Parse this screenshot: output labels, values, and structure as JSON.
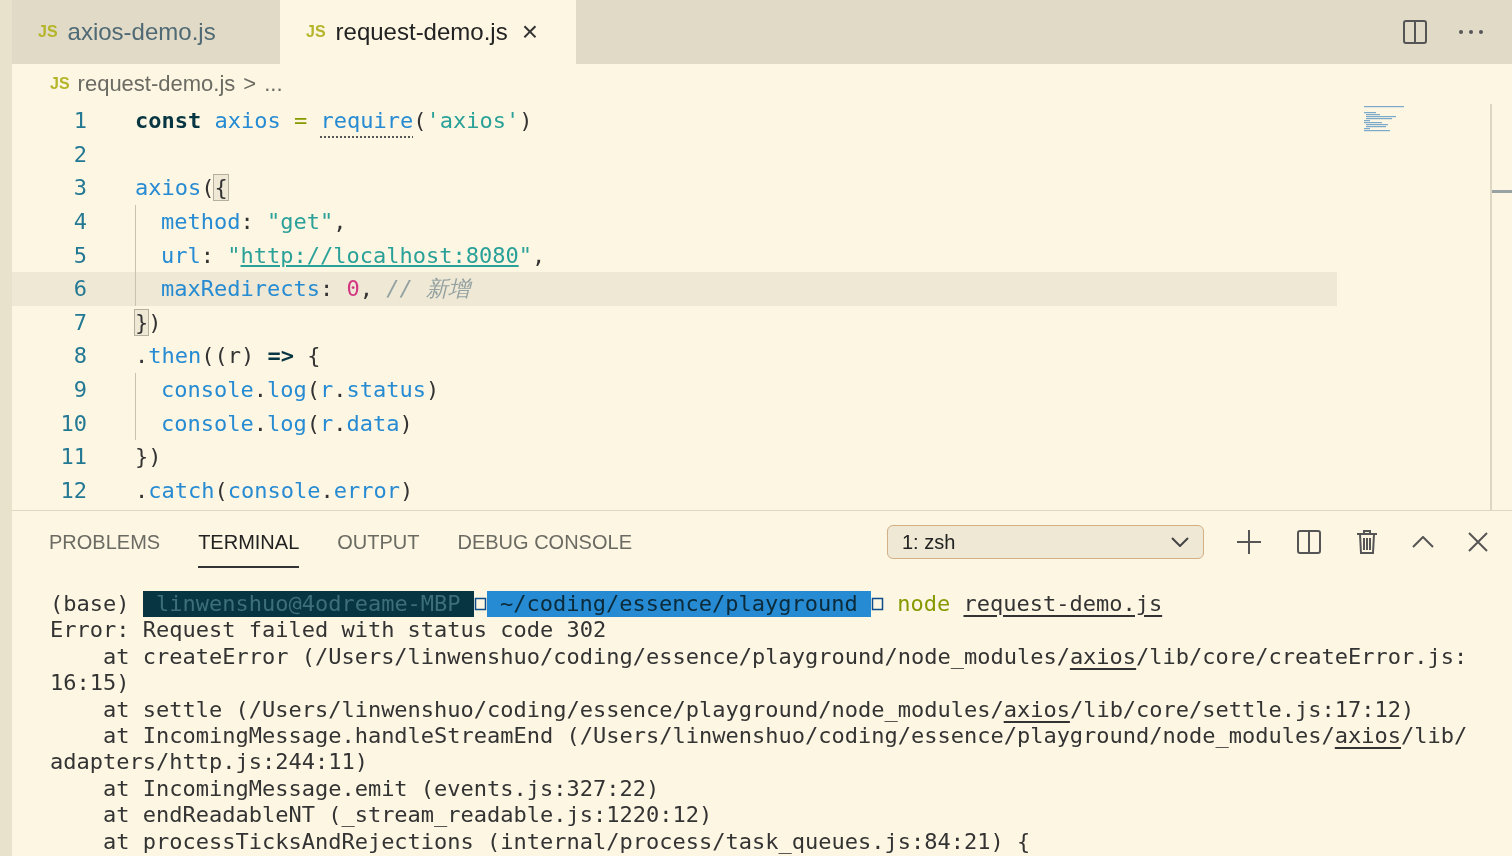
{
  "tabs": [
    {
      "label": "axios-demo.js",
      "badge": "JS",
      "selected": false
    },
    {
      "label": "request-demo.js",
      "badge": "JS",
      "selected": true,
      "close": "×"
    }
  ],
  "breadcrumb": {
    "badge": "JS",
    "file": "request-demo.js",
    "separator": ">",
    "rest": "..."
  },
  "editor": {
    "lines": [
      {
        "number": "1",
        "current": false,
        "tokens": [
          {
            "kind": "kw",
            "text": "const "
          },
          {
            "kind": "var",
            "text": "axios "
          },
          {
            "kind": "op",
            "text": "= "
          },
          {
            "kind": "hint",
            "text": "require"
          },
          {
            "kind": "punc",
            "text": "("
          },
          {
            "kind": "str",
            "text": "'axios'"
          },
          {
            "kind": "punc",
            "text": ")"
          }
        ]
      },
      {
        "number": "2",
        "current": false
      },
      {
        "number": "3",
        "current": false,
        "tokens": [
          {
            "kind": "var",
            "text": "axios"
          },
          {
            "kind": "punc",
            "text": "("
          },
          {
            "kind": "match",
            "text": "{"
          }
        ],
        "children": [
          {
            "number": "4",
            "current": false,
            "tokens": [
              {
                "kind": "var",
                "text": "method"
              },
              {
                "kind": "punc",
                "text": ": "
              },
              {
                "kind": "str",
                "text": "\"get\""
              },
              {
                "kind": "punc",
                "text": ","
              }
            ]
          },
          {
            "number": "5",
            "current": false,
            "tokens": [
              {
                "kind": "var",
                "text": "url"
              },
              {
                "kind": "punc",
                "text": ": "
              },
              {
                "kind": "str",
                "text": "\""
              },
              {
                "kind": "link",
                "text": "http://localhost:8080"
              },
              {
                "kind": "str",
                "text": "\""
              },
              {
                "kind": "punc",
                "text": ","
              }
            ]
          },
          {
            "number": "6",
            "current": true,
            "tokens": [
              {
                "kind": "var",
                "text": "maxRedirects"
              },
              {
                "kind": "punc",
                "text": ": "
              },
              {
                "kind": "num",
                "text": "0"
              },
              {
                "kind": "punc",
                "text": ", "
              },
              {
                "kind": "com",
                "text": "// 新增"
              }
            ]
          }
        ]
      },
      {
        "number": "7",
        "current": false,
        "tokens": [
          {
            "kind": "match",
            "text": "}"
          },
          {
            "kind": "punc",
            "text": ")"
          }
        ]
      },
      {
        "number": "8",
        "current": false,
        "tokens": [
          {
            "kind": "punc",
            "text": "."
          },
          {
            "kind": "fn",
            "text": "then"
          },
          {
            "kind": "punc",
            "text": "((r) "
          },
          {
            "kind": "kw",
            "text": "=>"
          },
          {
            "kind": "punc",
            "text": " {"
          }
        ],
        "children": [
          {
            "number": "9",
            "current": false,
            "tokens": [
              {
                "kind": "var",
                "text": "console"
              },
              {
                "kind": "punc",
                "text": "."
              },
              {
                "kind": "fn",
                "text": "log"
              },
              {
                "kind": "punc",
                "text": "("
              },
              {
                "kind": "var",
                "text": "r"
              },
              {
                "kind": "punc",
                "text": "."
              },
              {
                "kind": "var",
                "text": "status"
              },
              {
                "kind": "punc",
                "text": ")"
              }
            ]
          },
          {
            "number": "10",
            "current": false,
            "tokens": [
              {
                "kind": "var",
                "text": "console"
              },
              {
                "kind": "punc",
                "text": "."
              },
              {
                "kind": "fn",
                "text": "log"
              },
              {
                "kind": "punc",
                "text": "("
              },
              {
                "kind": "var",
                "text": "r"
              },
              {
                "kind": "punc",
                "text": "."
              },
              {
                "kind": "var",
                "text": "data"
              },
              {
                "kind": "punc",
                "text": ")"
              }
            ]
          }
        ]
      },
      {
        "number": "11",
        "current": false,
        "tokens": [
          {
            "kind": "punc",
            "text": "})"
          }
        ]
      },
      {
        "number": "12",
        "current": false,
        "tokens": [
          {
            "kind": "punc",
            "text": "."
          },
          {
            "kind": "fn",
            "text": "catch"
          },
          {
            "kind": "punc",
            "text": "("
          },
          {
            "kind": "var",
            "text": "console"
          },
          {
            "kind": "punc",
            "text": "."
          },
          {
            "kind": "var",
            "text": "error"
          },
          {
            "kind": "punc",
            "text": ")"
          }
        ]
      }
    ]
  },
  "panel": {
    "tabs": [
      {
        "label": "PROBLEMS",
        "selected": false
      },
      {
        "label": "TERMINAL",
        "selected": true
      },
      {
        "label": "OUTPUT",
        "selected": false
      },
      {
        "label": "DEBUG CONSOLE",
        "selected": false
      }
    ],
    "terminal_select": "1: zsh"
  },
  "terminal": {
    "prompt": [
      {
        "kind": "plain",
        "text": "(base) "
      },
      {
        "kind": "host",
        "text": " linwenshuo@4odreame-MBP "
      },
      {
        "kind": "path",
        "text": " ~/coding/essence/playground "
      },
      {
        "kind": "cmd",
        "text": " node "
      },
      {
        "kind": "arg",
        "text": "request-demo.js"
      }
    ],
    "lines": [
      [
        {
          "kind": "plain",
          "text": "Error: Request failed with status code 302"
        }
      ],
      [
        {
          "kind": "plain",
          "text": "    at createError (/Users/linwenshuo/coding/essence/playground/node_modules/"
        },
        {
          "kind": "link",
          "text": "axios"
        },
        {
          "kind": "plain",
          "text": "/lib/core/createError.js:"
        }
      ],
      [
        {
          "kind": "plain",
          "text": "16:15)"
        }
      ],
      [
        {
          "kind": "plain",
          "text": "    at settle (/Users/linwenshuo/coding/essence/playground/node_modules/"
        },
        {
          "kind": "link",
          "text": "axios"
        },
        {
          "kind": "plain",
          "text": "/lib/core/settle.js:17:12)"
        }
      ],
      [
        {
          "kind": "plain",
          "text": "    at IncomingMessage.handleStreamEnd (/Users/linwenshuo/coding/essence/playground/node_modules/"
        },
        {
          "kind": "link",
          "text": "axios"
        },
        {
          "kind": "plain",
          "text": "/lib/"
        }
      ],
      [
        {
          "kind": "plain",
          "text": "adapters/http.js:244:11)"
        }
      ],
      [
        {
          "kind": "plain",
          "text": "    at IncomingMessage.emit (events.js:327:22)"
        }
      ],
      [
        {
          "kind": "plain",
          "text": "    at endReadableNT (_stream_readable.js:1220:12)"
        }
      ],
      [
        {
          "kind": "plain",
          "text": "    at processTicksAndRejections (internal/process/task_queues.js:84:21) {"
        }
      ]
    ]
  }
}
